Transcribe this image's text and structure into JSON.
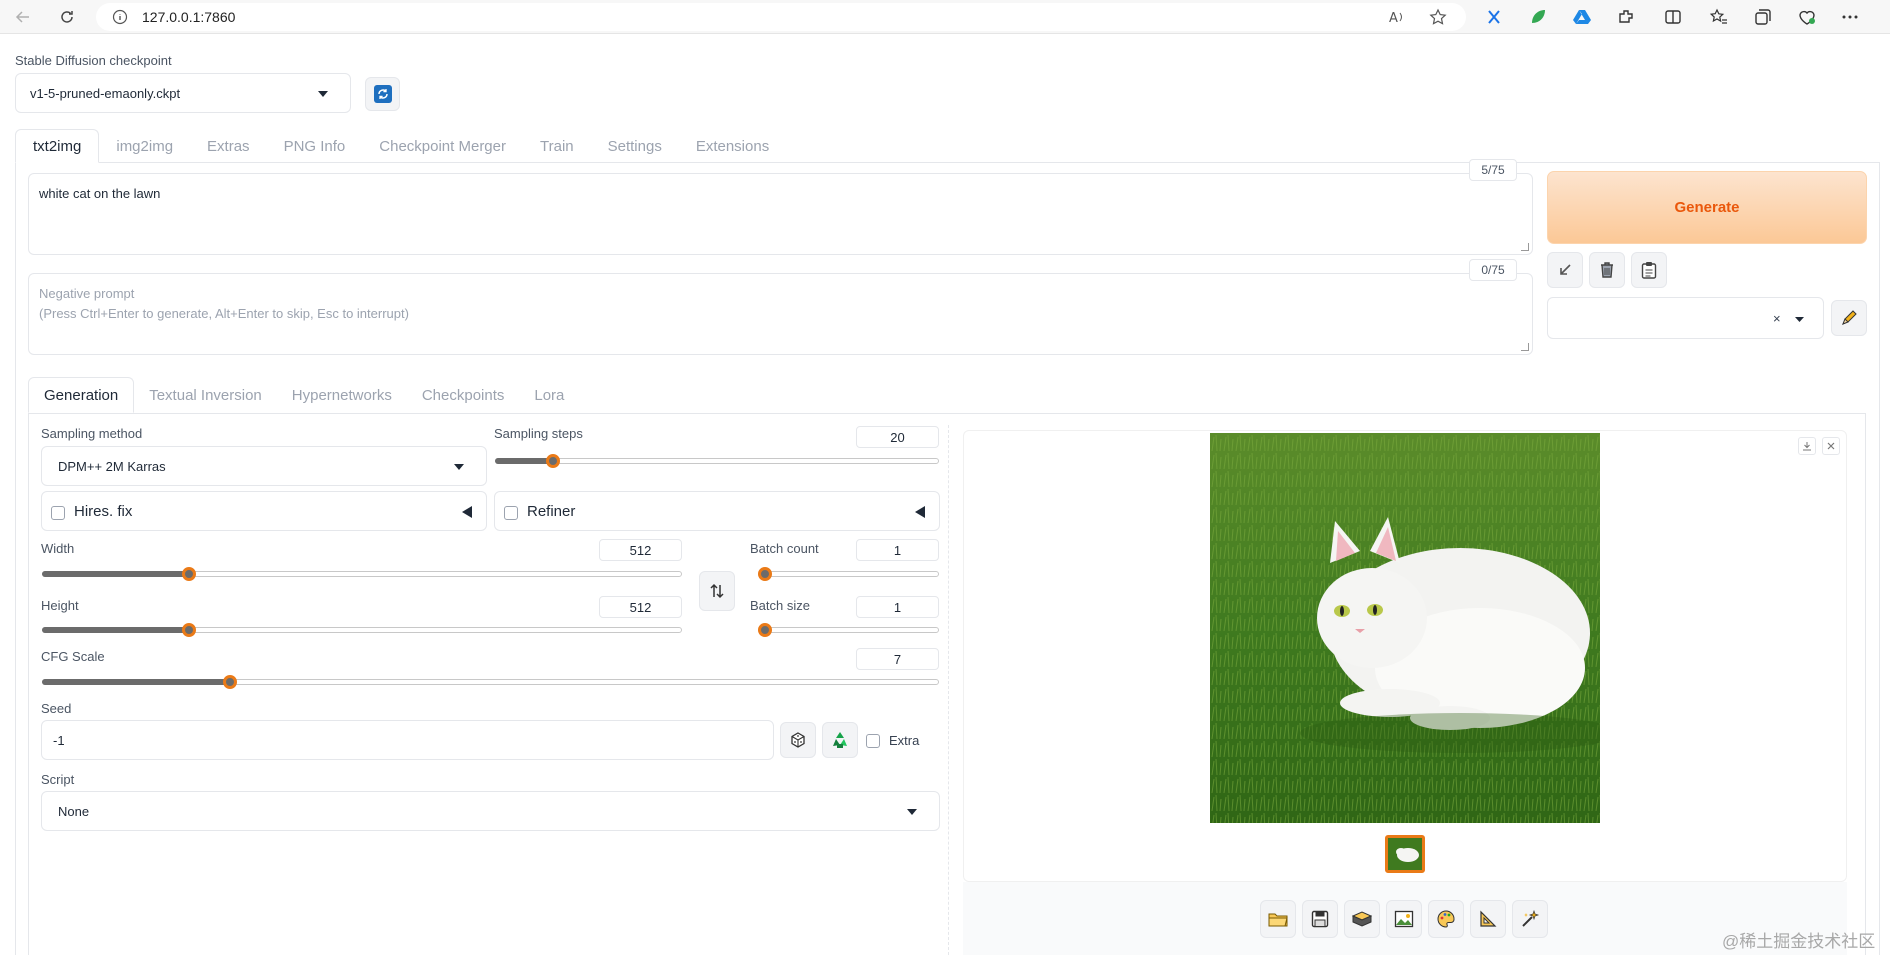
{
  "browser": {
    "url": "127.0.0.1:7860"
  },
  "checkpoint": {
    "label": "Stable Diffusion checkpoint",
    "value": "v1-5-pruned-emaonly.ckpt"
  },
  "main_tabs": [
    "txt2img",
    "img2img",
    "Extras",
    "PNG Info",
    "Checkpoint Merger",
    "Train",
    "Settings",
    "Extensions"
  ],
  "prompt": {
    "value": "white cat on the lawn",
    "counter": "5/75"
  },
  "negative_prompt": {
    "placeholder_line1": "Negative prompt",
    "placeholder_line2": "(Press Ctrl+Enter to generate, Alt+Enter to skip, Esc to interrupt)",
    "counter": "0/75"
  },
  "generate_label": "Generate",
  "styles": {
    "clear": "×"
  },
  "sub_tabs": [
    "Generation",
    "Textual Inversion",
    "Hypernetworks",
    "Checkpoints",
    "Lora"
  ],
  "sampling_method": {
    "label": "Sampling method",
    "value": "DPM++ 2M Karras"
  },
  "sampling_steps": {
    "label": "Sampling steps",
    "value": "20",
    "fraction": 0.13
  },
  "hires_fix": {
    "label": "Hires. fix"
  },
  "refiner": {
    "label": "Refiner"
  },
  "width": {
    "label": "Width",
    "value": "512",
    "fraction": 0.23
  },
  "height": {
    "label": "Height",
    "value": "512",
    "fraction": 0.23
  },
  "batch_count": {
    "label": "Batch count",
    "value": "1",
    "fraction": 0.0
  },
  "batch_size": {
    "label": "Batch size",
    "value": "1",
    "fraction": 0.0
  },
  "cfg_scale": {
    "label": "CFG Scale",
    "value": "7",
    "fraction": 0.21
  },
  "seed": {
    "label": "Seed",
    "value": "-1",
    "extra_label": "Extra"
  },
  "script": {
    "label": "Script",
    "value": "None"
  },
  "watermark": "@稀土掘金技术社区",
  "colors": {
    "accent": "#ea580c",
    "generate_from": "#fde4cf",
    "generate_to": "#fbc896"
  },
  "icons": [
    "refresh-icon",
    "arrow-icon",
    "trash-icon",
    "clipboard-icon",
    "pencil-icon",
    "swap-icon",
    "dice-icon",
    "recycle-icon",
    "folder-icon",
    "save-icon",
    "zip-icon",
    "image-icon",
    "palette-icon",
    "ruler-icon",
    "sparkle-icon"
  ]
}
